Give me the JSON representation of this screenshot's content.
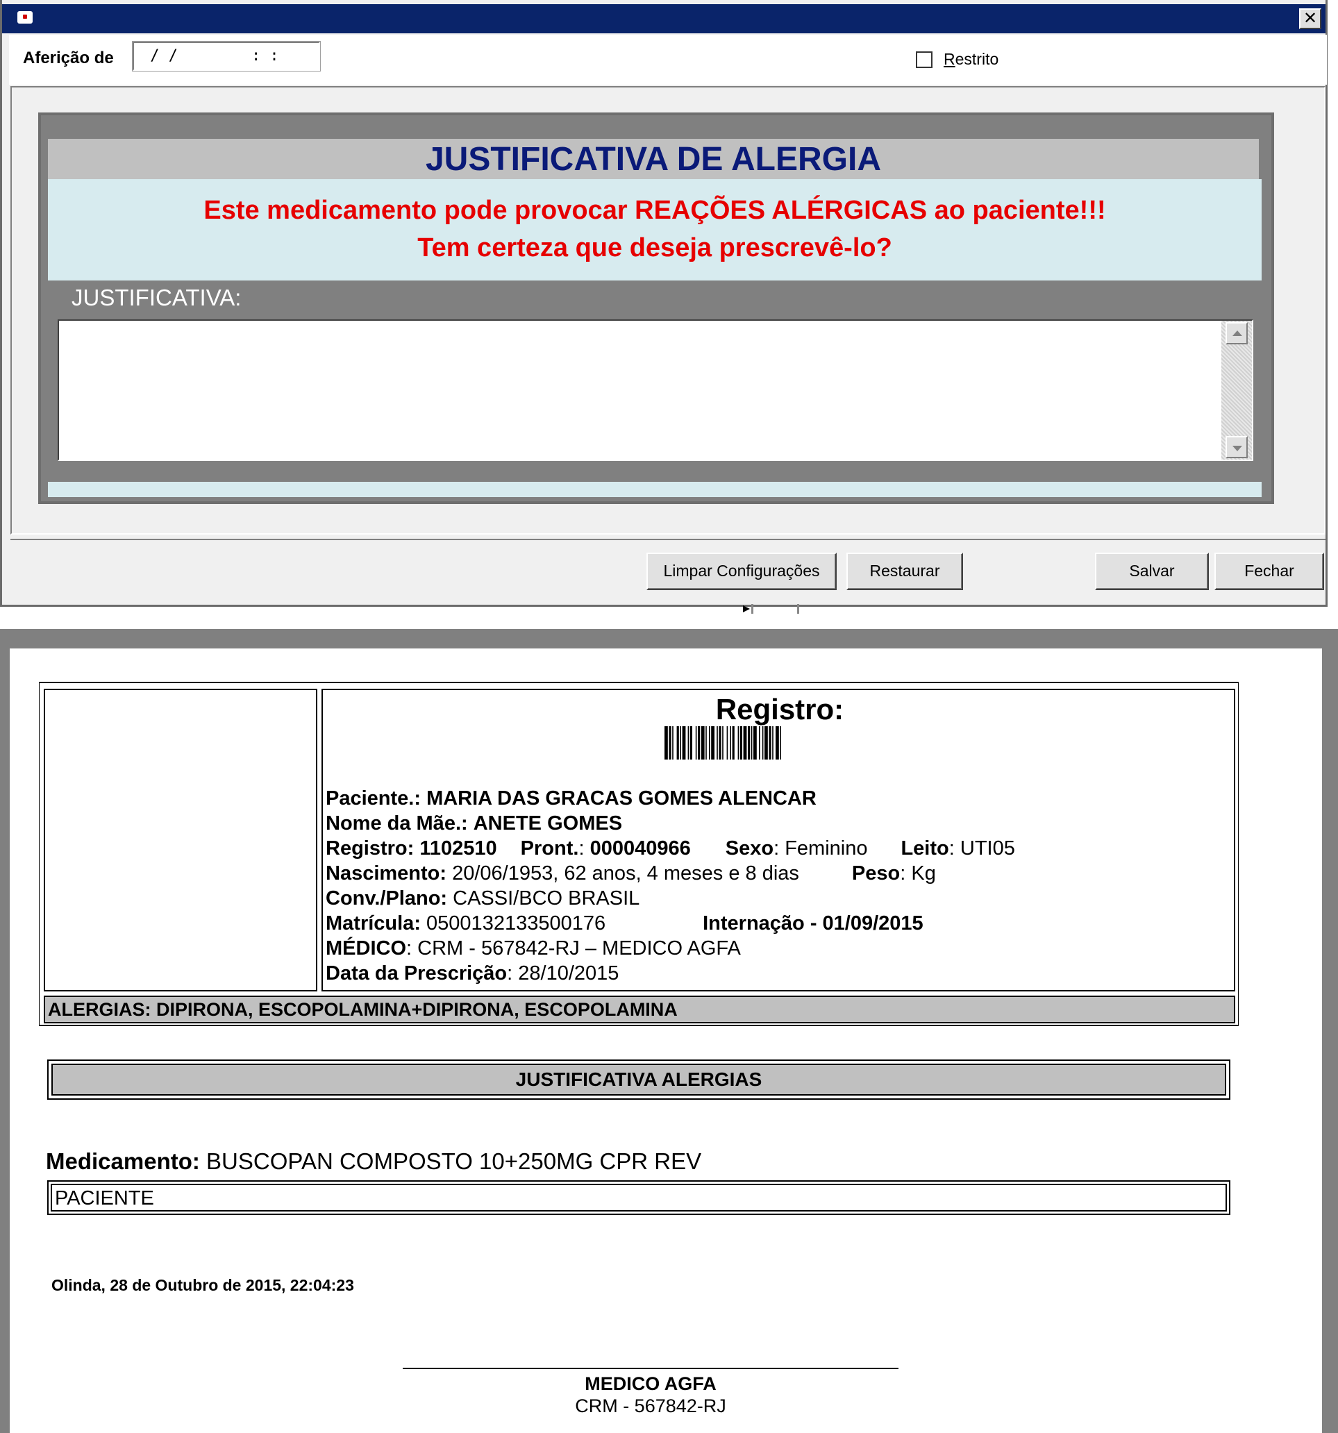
{
  "dialog": {
    "close_glyph": "✕",
    "afericao_label": "Aferição de",
    "afericao_value": " / /        : :",
    "restrito_label": "Restrito",
    "restrito_checked": false
  },
  "alert": {
    "title": "JUSTIFICATIVA DE ALERGIA",
    "line1": "Este medicamento pode provocar REAÇÕES ALÉRGICAS ao paciente!!!",
    "line2": "Tem certeza que deseja prescrevê-lo?",
    "justificativa_label": "JUSTIFICATIVA:",
    "justificativa_value": "",
    "title_color": "#0a1a78",
    "message_color": "#e60000"
  },
  "buttons": {
    "limpar": "Limpar Configurações",
    "restaurar": "Restaurar",
    "salvar": "Salvar",
    "fechar": "Fechar"
  },
  "report": {
    "registro_title": "Registro:",
    "paciente_label": "Paciente.:",
    "paciente": "MARIA DAS GRACAS GOMES ALENCAR",
    "mae_label": "Nome da Mãe.:",
    "mae": "ANETE GOMES",
    "registro_label": "Registro:",
    "registro": "1102510",
    "pront_label": "Pront.",
    "pront": "000040966",
    "sexo_label": "Sexo",
    "sexo": "Feminino",
    "leito_label": "Leito",
    "leito": "UTI05",
    "nascimento_label": "Nascimento:",
    "nascimento": "20/06/1953, 62 anos, 4 meses e 8 dias",
    "peso_label": "Peso",
    "peso": "Kg",
    "conv_label": "Conv./Plano:",
    "conv": "CASSI/BCO BRASIL",
    "matricula_label": "Matrícula:",
    "matricula": "0500132133500176",
    "internacao_label": "Internação -",
    "internacao": "01/09/2015",
    "medico_label": "MÉDICO",
    "medico": "CRM - 567842-RJ – MEDICO AGFA",
    "data_prescricao_label": "Data da Prescrição",
    "data_prescricao": "28/10/2015",
    "alergias": "ALERGIAS: DIPIRONA, ESCOPOLAMINA+DIPIRONA, ESCOPOLAMINA",
    "justificativa_header": "JUSTIFICATIVA ALERGIAS",
    "medicamento_label": "Medicamento:",
    "medicamento": "BUSCOPAN COMPOSTO 10+250MG CPR REV",
    "justificativa_texto": "PACIENTE",
    "local_data": "Olinda, 28 de Outubro de 2015, 22:04:23",
    "assinatura_nome": "MEDICO AGFA",
    "assinatura_crm": "CRM - 567842-RJ"
  }
}
